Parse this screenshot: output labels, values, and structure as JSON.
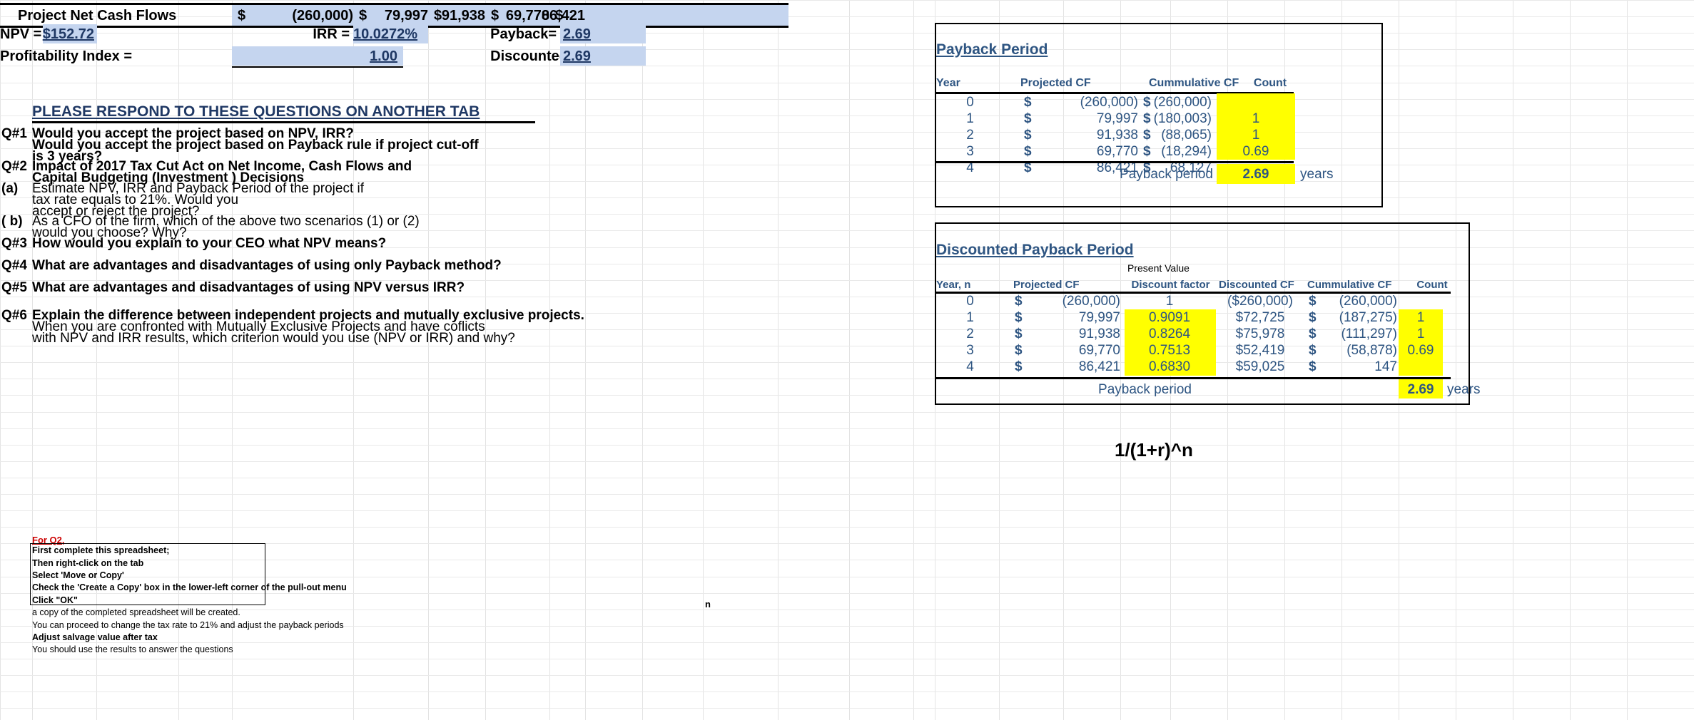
{
  "summary": {
    "net_cash_flow_label": "Project Net Cash Flows",
    "currency": "$",
    "cash_flows": [
      "(260,000)",
      "79,997",
      "91,938",
      "69,770",
      "86,421"
    ],
    "npv_label": "NPV =",
    "npv_value": "$152.72",
    "irr_label": "IRR =",
    "irr_value": "10.0272%",
    "payback_label": "Payback=",
    "payback_value": "2.69",
    "pi_label": "Profitability Index  =",
    "pi_value": "1.00",
    "discounted_payback_label": "Discounted Payback =",
    "discounted_payback_value": "2.69"
  },
  "instructions_heading": "PLEASE RESPOND TO THESE QUESTIONS ON ANOTHER TAB",
  "questions": [
    {
      "tag": "Q#1",
      "lines": [
        {
          "text": "Would you accept the project based on NPV, IRR?",
          "bold": true
        },
        {
          "text": "Would you accept the project based on Payback rule if project cut-off",
          "bold": true
        },
        {
          "text": "is 3 years?",
          "bold": true
        }
      ]
    },
    {
      "tag": "Q#2",
      "lines": [
        {
          "text": "Impact of 2017 Tax Cut Act on  Net Income, Cash Flows and",
          "bold": true
        },
        {
          "text": "Capital Budgeting (Investment ) Decisions",
          "bold": true
        }
      ]
    },
    {
      "tag": "(a)",
      "lines": [
        {
          "text": "Estimate NPV, IRR and Payback Period of the project if",
          "bold": false
        },
        {
          "text": " tax rate  equals to 21%.  Would you",
          "bold": false
        },
        {
          "text": "accept  or reject the project?",
          "bold": false
        }
      ]
    },
    {
      "tag": "( b)",
      "lines": [
        {
          "text": "As a CFO of the firm, which of the above two  scenarios (1) or (2)",
          "bold": false
        },
        {
          "text": "would you choose? Why?",
          "bold": false
        }
      ]
    },
    {
      "tag": "Q#3",
      "lines": [
        {
          "text": "How would you  explain to your CEO what NPV means?",
          "bold": true
        }
      ]
    },
    {
      "tag": "Q#4",
      "lines": [
        {
          "text": "What are  advantages and disadvantages of using only Payback method?",
          "bold": true
        }
      ]
    },
    {
      "tag": "Q#5",
      "lines": [
        {
          "text": "What are advantages and disadvantages of using NPV versus IRR?",
          "bold": true
        }
      ]
    },
    {
      "tag": "Q#6",
      "lines": [
        {
          "text": "Explain the difference between independent projects and mutually exclusive projects.",
          "bold": true
        },
        {
          "text": "When you are confronted with Mutually Exclusive Projects and have coflicts",
          "bold": false
        },
        {
          "text": "with NPV and IRR results, which criterion would you use (NPV or IRR) and why?",
          "bold": false
        }
      ]
    }
  ],
  "note": {
    "title": "For Q2,",
    "boxed_lines": [
      "First complete this spreadsheet;",
      "Then right-click on the tab",
      "Select 'Move or Copy'",
      "Check the 'Create a Copy' box in the lower-left corner of the pull-out menu",
      "Click \"OK\""
    ],
    "trailing_lines": [
      {
        "text": "a copy of the completed spreadsheet will be created.",
        "bold": false
      },
      {
        "text": "You can proceed to change the tax rate to 21% and adjust the payback periods",
        "bold": false
      },
      {
        "text": "Adjust salvage value after tax",
        "bold": true
      },
      {
        "text": "You should use the results to answer the questions",
        "bold": false
      }
    ]
  },
  "stray_cell": "n",
  "formula_note": "1/(1+r)^n",
  "payback_table": {
    "title": "Payback Period",
    "headers": [
      "Year",
      "Projected CF",
      "Cummulative CF",
      "Count"
    ],
    "rows": [
      {
        "year": "0",
        "cf_sym": "$",
        "cf": "(260,000)",
        "cum_sym": "$",
        "cum": "(260,000)",
        "count": ""
      },
      {
        "year": "1",
        "cf_sym": "$",
        "cf": "79,997",
        "cum_sym": "$",
        "cum": "(180,003)",
        "count": "1"
      },
      {
        "year": "2",
        "cf_sym": "$",
        "cf": "91,938",
        "cum_sym": "$",
        "cum": "(88,065)",
        "count": "1"
      },
      {
        "year": "3",
        "cf_sym": "$",
        "cf": "69,770",
        "cum_sym": "$",
        "cum": "(18,294)",
        "count": "0.69"
      },
      {
        "year": "4",
        "cf_sym": "$",
        "cf": "86,421",
        "cum_sym": "$",
        "cum": "68,127",
        "count": ""
      }
    ],
    "total_label": "Payback period",
    "total_value": "2.69",
    "units": "years"
  },
  "discounted_table": {
    "title": "Discounted Payback Period",
    "present_value_label": "Present Value",
    "headers": [
      "Year, n",
      "Projected CF",
      "Discount factor",
      "Discounted CF",
      "Cummulative CF",
      "Count"
    ],
    "rows": [
      {
        "year": "0",
        "cf_sym": "$",
        "cf": "(260,000)",
        "df": "1",
        "dcf": "($260,000)",
        "cum_sym": "$",
        "cum": "(260,000)",
        "count": ""
      },
      {
        "year": "1",
        "cf_sym": "$",
        "cf": "79,997",
        "df": "0.9091",
        "dcf": "$72,725",
        "cum_sym": "$",
        "cum": "(187,275)",
        "count": "1"
      },
      {
        "year": "2",
        "cf_sym": "$",
        "cf": "91,938",
        "df": "0.8264",
        "dcf": "$75,978",
        "cum_sym": "$",
        "cum": "(111,297)",
        "count": "1"
      },
      {
        "year": "3",
        "cf_sym": "$",
        "cf": "69,770",
        "df": "0.7513",
        "dcf": "$52,419",
        "cum_sym": "$",
        "cum": "(58,878)",
        "count": "0.69"
      },
      {
        "year": "4",
        "cf_sym": "$",
        "cf": "86,421",
        "df": "0.6830",
        "dcf": "$59,025",
        "cum_sym": "$",
        "cum": "147",
        "count": ""
      }
    ],
    "total_label": "Payback period",
    "total_value": "2.69",
    "units": "years"
  },
  "colors": {
    "highlight": "#ffff00",
    "fill": "#c5d5ef",
    "header_text": "#2e5582",
    "note_title": "#cc0000"
  }
}
